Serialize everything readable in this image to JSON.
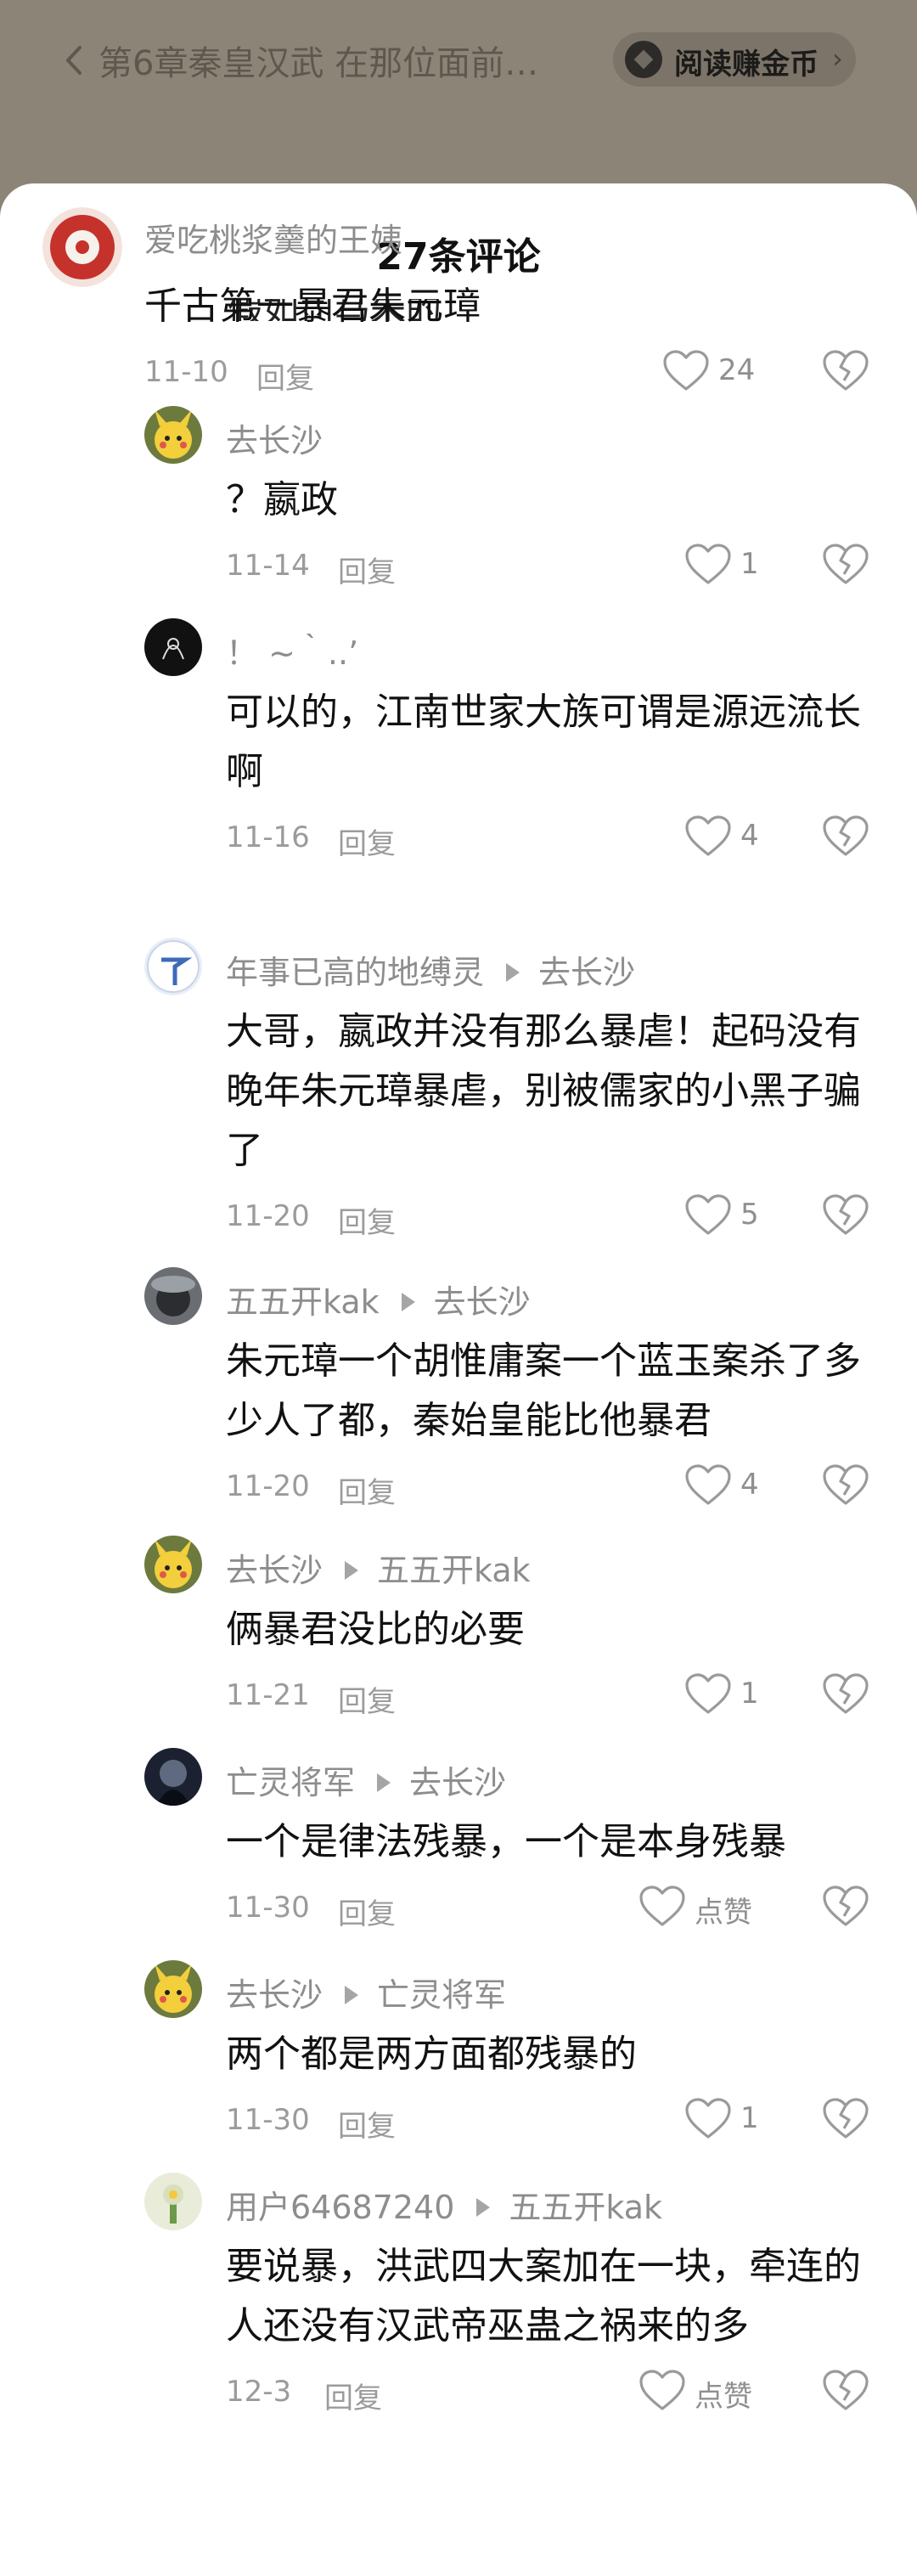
{
  "reader_bar": {
    "back_icon": "chevron-left-icon",
    "chapter_title": "第6章秦皇汉武 在那位面前…",
    "earn_label": "阅读赚金币",
    "earn_arrow": "›"
  },
  "sheet": {
    "title": "27条评论",
    "close_icon": "chevron-down-icon",
    "clipped_text": "假如司马朱的"
  },
  "comments": [
    {
      "user": "爱吃桃浆羹的王姨",
      "reply_to": "",
      "body": "千古第一暴君朱元璋",
      "date": "11-10",
      "reply_label": "回复",
      "likes": "24"
    },
    {
      "user": "去长沙",
      "reply_to": "",
      "body": "？嬴政",
      "date": "11-14",
      "reply_label": "回复",
      "likes": "1"
    },
    {
      "user": "！ ~｀..’",
      "reply_to": "",
      "body": "可以的，江南世家大族可谓是源远流长啊",
      "date": "11-16",
      "reply_label": "回复",
      "likes": "4"
    },
    {
      "user": "年事已高的地缚灵",
      "reply_to": "去长沙",
      "body": "大哥，嬴政并没有那么暴虐！起码没有晚年朱元璋暴虐，别被儒家的小黑子骗了",
      "date": "11-20",
      "reply_label": "回复",
      "likes": "5"
    },
    {
      "user": "五五开kak",
      "reply_to": "去长沙",
      "body": "朱元璋一个胡惟庸案一个蓝玉案杀了多少人了都，秦始皇能比他暴君",
      "date": "11-20",
      "reply_label": "回复",
      "likes": "4"
    },
    {
      "user": "去长沙",
      "reply_to": "五五开kak",
      "body": "俩暴君没比的必要",
      "date": "11-21",
      "reply_label": "回复",
      "likes": "1"
    },
    {
      "user": "亡灵将军",
      "reply_to": "去长沙",
      "body": "一个是律法残暴，一个是本身残暴",
      "date": "11-30",
      "reply_label": "回复",
      "likes": "点赞"
    },
    {
      "user": "去长沙",
      "reply_to": "亡灵将军",
      "body": "两个都是两方面都残暴的",
      "date": "11-30",
      "reply_label": "回复",
      "likes": "1"
    },
    {
      "user": "用户64687240",
      "reply_to": "五五开kak",
      "body": "要说暴，洪武四大案加在一块，牵连的人还没有汉武帝巫蛊之祸来的多",
      "date": "12-3",
      "reply_label": "回复",
      "likes": "点赞"
    }
  ],
  "icons": {
    "like": "heart-outline-icon",
    "dislike": "broken-heart-icon"
  },
  "colors": {
    "backdrop": "#8d8478",
    "sheet": "#ffffff",
    "meta_text": "#9b9b9b",
    "body_text": "#111111"
  }
}
